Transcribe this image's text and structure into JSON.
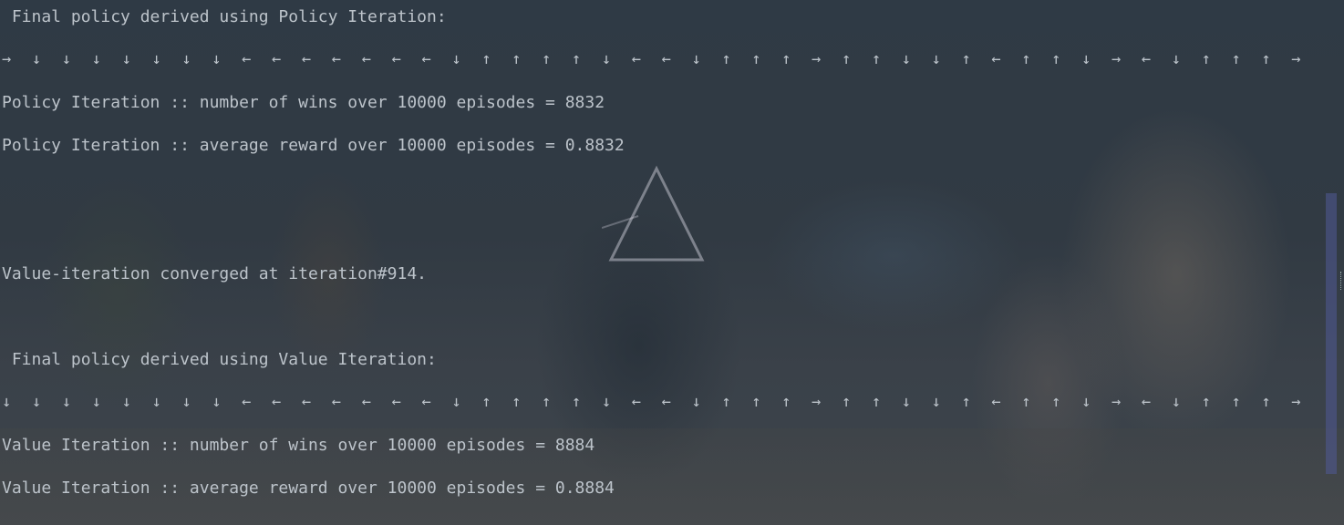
{
  "console": {
    "policy_header": " Final policy derived using Policy Iteration:",
    "policy_arrows": [
      "→",
      "↓",
      "↓",
      "↓",
      "↓",
      "↓",
      "↓",
      "↓",
      "←",
      "←",
      "←",
      "←",
      "←",
      "←",
      "←",
      "↓",
      "↑",
      "↑",
      "↑",
      "↑",
      "↓",
      "←",
      "←",
      "↓",
      "↑",
      "↑",
      "↑",
      "→",
      "↑",
      "↑",
      "↓",
      "↓",
      "↑",
      "←",
      "↑",
      "↑",
      "↓",
      "→",
      "←",
      "↓",
      "↑",
      "↑",
      "↑",
      "→"
    ],
    "policy_wins": "Policy Iteration :: number of wins over 10000 episodes = 8832",
    "policy_reward": "Policy Iteration :: average reward over 10000 episodes = 0.8832",
    "value_converged": "Value-iteration converged at iteration#914.",
    "value_header": " Final policy derived using Value Iteration:",
    "value_arrows": [
      "↓",
      "↓",
      "↓",
      "↓",
      "↓",
      "↓",
      "↓",
      "↓",
      "←",
      "←",
      "←",
      "←",
      "←",
      "←",
      "←",
      "↓",
      "↑",
      "↑",
      "↑",
      "↑",
      "↓",
      "←",
      "←",
      "↓",
      "↑",
      "↑",
      "↑",
      "→",
      "↑",
      "↑",
      "↓",
      "↓",
      "↑",
      "←",
      "↑",
      "↑",
      "↓",
      "→",
      "←",
      "↓",
      "↑",
      "↑",
      "↑",
      "→"
    ],
    "value_wins": "Value Iteration :: number of wins over 10000 episodes = 8884",
    "value_reward": "Value Iteration :: average reward over 10000 episodes = 0.8884"
  },
  "colors": {
    "text": "#bcc3ca",
    "background": "#2a3540",
    "scroll_thumb": "#505a96"
  }
}
